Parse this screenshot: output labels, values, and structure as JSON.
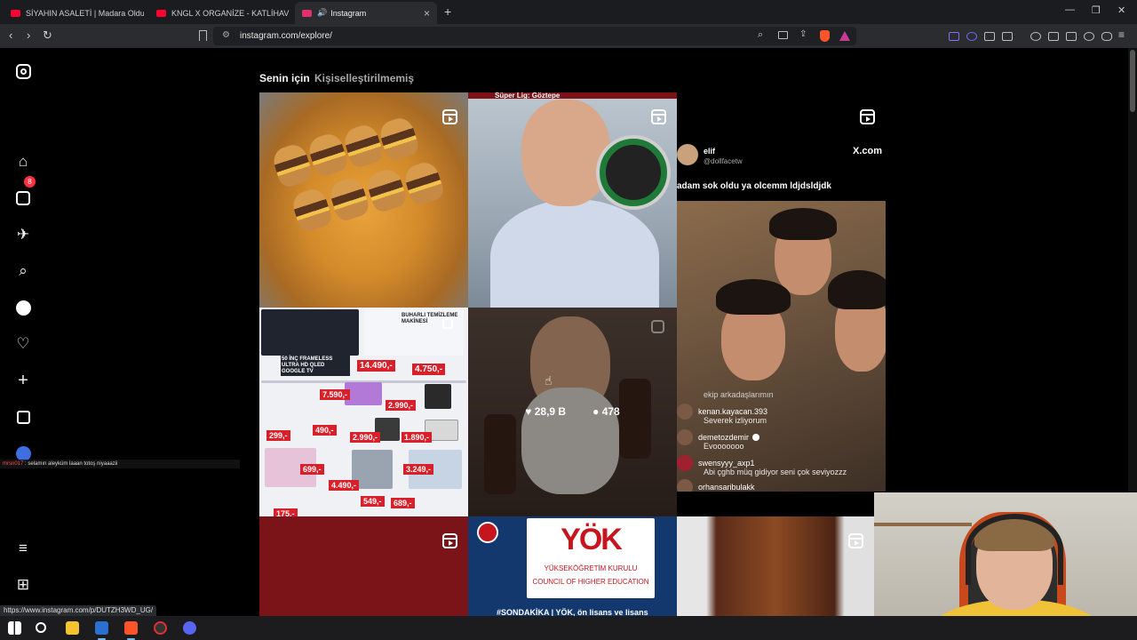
{
  "browser": {
    "tabs": [
      {
        "title": "SİYAHIN ASALETİ | Madara Olduk #6",
        "favicon": "youtube-icon",
        "color": "#ff0033"
      },
      {
        "title": "KNGL X ORGANİZE - KATLİHAV 4 (OF",
        "favicon": "youtube-icon",
        "color": "#ff0033"
      },
      {
        "title": "Instagram",
        "favicon": "instagram-icon",
        "color": "#e1306c",
        "active": true
      }
    ],
    "url": "instagram.com/explore/",
    "status_url": "https://www.instagram.com/p/DUTZH3WD_UG/"
  },
  "sidebar": {
    "notification_count": "8"
  },
  "chat_overlay": {
    "user": "mrsn017",
    "message": ": selamın aleyküm laaan totoş niyaaazii"
  },
  "explore": {
    "tabs": [
      {
        "label": "Senin için"
      },
      {
        "label": "Kişiselleştirilmemiş"
      }
    ],
    "hover_post": {
      "likes": "28,9 B",
      "comments": "478"
    },
    "posts": {
      "p2_banner": "Süper Lig: Göztepe",
      "p3_username": "elif",
      "p3_handle": "@dollfacetw",
      "p3_source": "X.com",
      "p3_caption": "adam sok oldu ya olcemm ldjdsldjdk",
      "p3_comments": [
        {
          "user": "",
          "text": "ekip arkadaşlarımın"
        },
        {
          "user": "kenan.kayacan.393",
          "text": "Severek izliyorum"
        },
        {
          "user": "demetozdemir",
          "text": "Evooooooo"
        },
        {
          "user": "swensyyy_axp1",
          "text": "Abi çghb müq gidiyor seni çok seviyozzz"
        },
        {
          "user": "orhansaribulakk",
          "text": ""
        }
      ],
      "p4_ad": {
        "headline": "BUHARLI TEMİZLEME MAKİNESİ",
        "tv": "50 İNÇ FRAMELESS ULTRA HD QLED GOOGLE TV",
        "price_tv": "14.490,-",
        "price_cleaner": "4.750,-",
        "prices": [
          "7.590,-",
          "2.990,-",
          "299,-",
          "490,-",
          "2.990,-",
          "1.890,-",
          "699,-",
          "4.490,-",
          "3.249,-",
          "549,-",
          "689,-",
          "175,-"
        ]
      },
      "p7_org_tr": "YÜKSEKÖĞRETİM KURULU",
      "p7_org_en": "COUNCIL OF HIGHER EDUCATION",
      "p7_logo": "YÖK",
      "p7_caption": "#SONDAKİKA | YÖK, ön lisans ve lisans"
    }
  },
  "colors": {
    "instagram_bg": "#000000",
    "tab_active": "#f5f5f5",
    "tab_inactive": "#a8a8a8",
    "badge": "#ff3040"
  }
}
